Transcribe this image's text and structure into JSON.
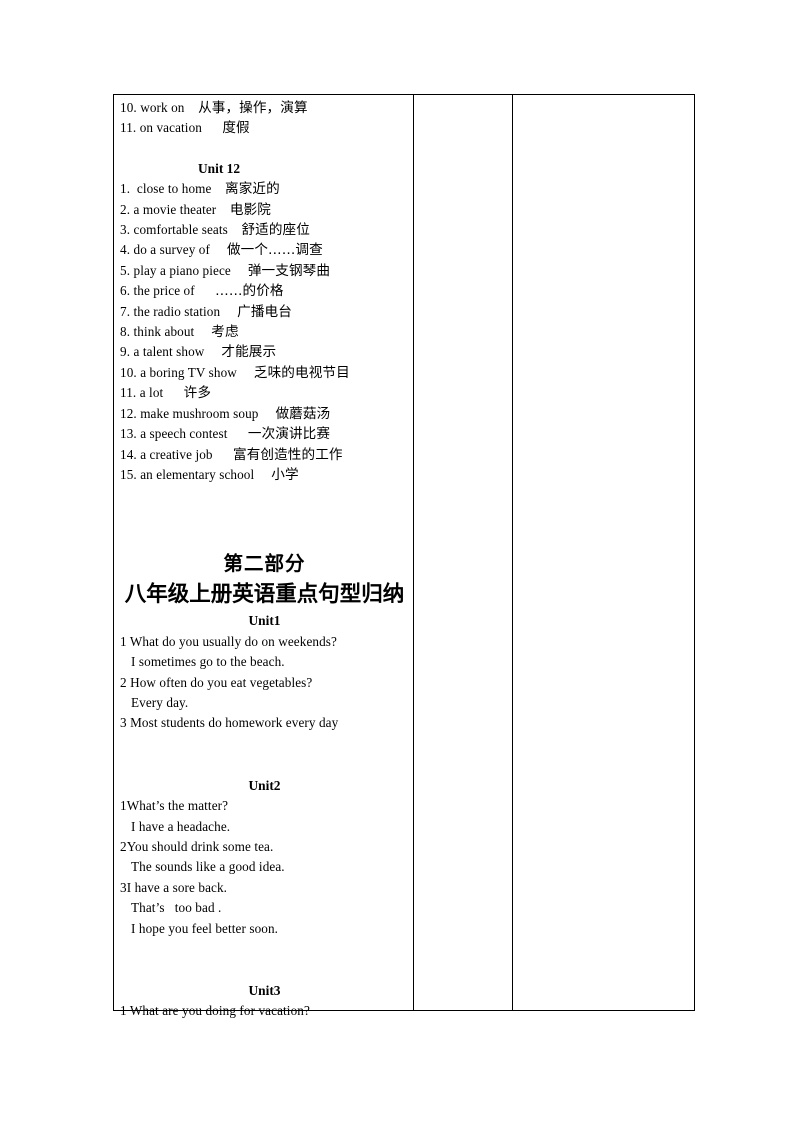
{
  "document": {
    "table": {
      "columns": 3,
      "main_column_label": "content-column",
      "empty_columns": [
        "middle-column",
        "right-column"
      ]
    }
  },
  "vocab_continued": {
    "items": [
      {
        "num": "10.",
        "en": "work on",
        "cn": "从事，操作，演算",
        "gap": "    "
      },
      {
        "num": "11.",
        "en": "on vacation",
        "cn": "度假",
        "gap": "      "
      }
    ]
  },
  "unit12": {
    "heading": "Unit 12",
    "items": [
      {
        "num": "1.",
        "en": " close to home",
        "gap": "    ",
        "cn": "离家近的"
      },
      {
        "num": "2.",
        "en": "a movie theater",
        "gap": "    ",
        "cn": "电影院"
      },
      {
        "num": "3.",
        "en": "comfortable seats",
        "gap": "    ",
        "cn": "舒适的座位"
      },
      {
        "num": "4.",
        "en": "do a survey of",
        "gap": "     ",
        "cn": "做一个……调查"
      },
      {
        "num": "5.",
        "en": "play a piano piece",
        "gap": "     ",
        "cn": "弹一支钢琴曲"
      },
      {
        "num": "6.",
        "en": "the price of",
        "gap": "      ",
        "cn": "……的价格"
      },
      {
        "num": "7.",
        "en": "the radio station",
        "gap": "     ",
        "cn": "广播电台"
      },
      {
        "num": "8.",
        "en": "think about",
        "gap": "     ",
        "cn": "考虑"
      },
      {
        "num": "9.",
        "en": "a talent show",
        "gap": "     ",
        "cn": "才能展示"
      },
      {
        "num": "10.",
        "en": "a boring TV show",
        "gap": "     ",
        "cn": "乏味的电视节目"
      },
      {
        "num": "11.",
        "en": "a lot",
        "gap": "      ",
        "cn": "许多"
      },
      {
        "num": "12.",
        "en": "make mushroom soup",
        "gap": "     ",
        "cn": "做蘑菇汤"
      },
      {
        "num": "13.",
        "en": "a speech contest",
        "gap": "      ",
        "cn": "一次演讲比赛"
      },
      {
        "num": "14.",
        "en": "a creative job",
        "gap": "      ",
        "cn": "富有创造性的工作"
      },
      {
        "num": "15.",
        "en": "an elementary school",
        "gap": "     ",
        "cn": "小学"
      }
    ]
  },
  "part_two": {
    "label": "第二部分",
    "title": "八年级上册英语重点句型归纳"
  },
  "sentences": {
    "unit1": {
      "heading": "Unit1",
      "lines": [
        {
          "text": "1 What do you usually do on weekends?",
          "indent": false
        },
        {
          "text": "I sometimes go to the beach.",
          "indent": true
        },
        {
          "text": "2 How often do you eat vegetables?",
          "indent": false
        },
        {
          "text": "Every day.",
          "indent": true
        },
        {
          "text": "3 Most students do homework every day",
          "indent": false
        }
      ]
    },
    "unit2": {
      "heading": "Unit2",
      "lines": [
        {
          "text": "1What’s the matter?",
          "indent": false
        },
        {
          "text": "I have a headache.",
          "indent": true
        },
        {
          "text": "2You should drink some tea.",
          "indent": false
        },
        {
          "text": "The sounds like a good idea.",
          "indent": true
        },
        {
          "text": "3I have a sore back.",
          "indent": false
        },
        {
          "text": "That’s   too bad .",
          "indent": true
        },
        {
          "text": "I hope you feel better soon.",
          "indent": true
        }
      ]
    },
    "unit3": {
      "heading": "Unit3",
      "lines": [
        {
          "text": "1 What are you doing for vacation?",
          "indent": false
        }
      ]
    }
  }
}
